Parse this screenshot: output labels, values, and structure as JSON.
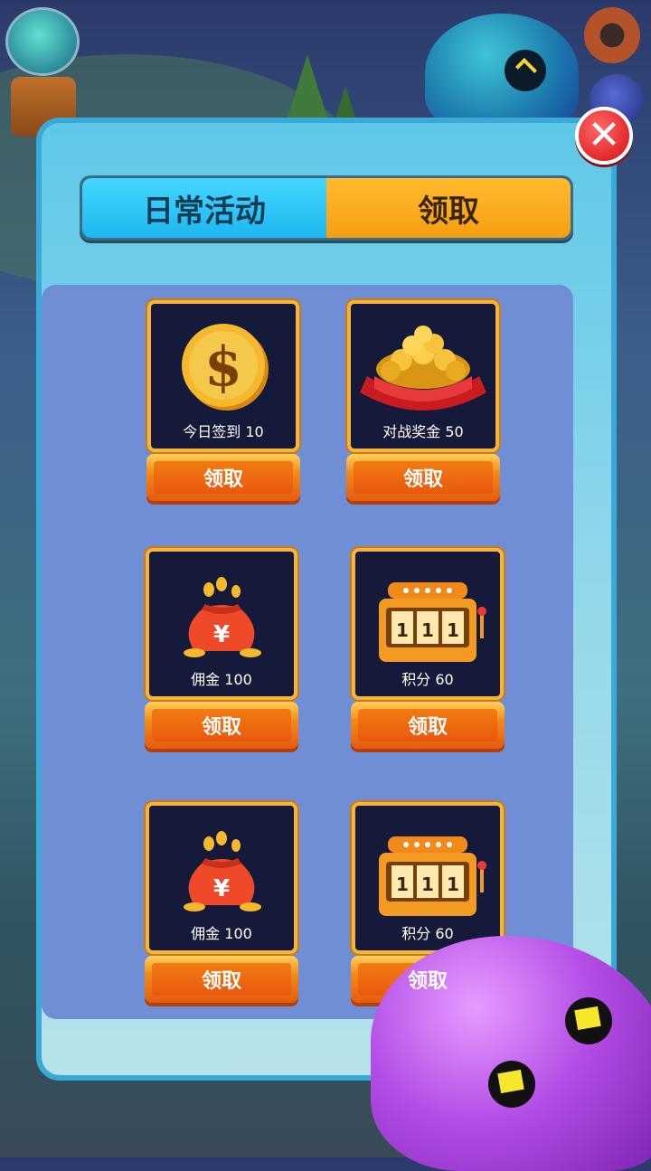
{
  "tabs": {
    "daily_label": "日常活动",
    "claim_label": "领取"
  },
  "rewards": [
    {
      "label": "今日签到 10",
      "icon": "dollar-coin-icon",
      "button": "领取"
    },
    {
      "label": "对战奖金 50",
      "icon": "gold-coin-pile-icon",
      "button": "领取"
    },
    {
      "label": "佣金 100",
      "icon": "money-bag-icon",
      "button": "领取"
    },
    {
      "label": "积分 60",
      "icon": "slot-machine-icon",
      "button": "领取"
    },
    {
      "label": "佣金 100",
      "icon": "money-bag-icon",
      "button": "领取"
    },
    {
      "label": "积分 60",
      "icon": "slot-machine-icon",
      "button": "领取"
    }
  ],
  "colors": {
    "tab_active": "#1db6ef",
    "tab_inactive": "#f69e12",
    "panel_inner": "#6f8ed6",
    "card_border": "#f3b53e",
    "button": "#e8590e"
  }
}
